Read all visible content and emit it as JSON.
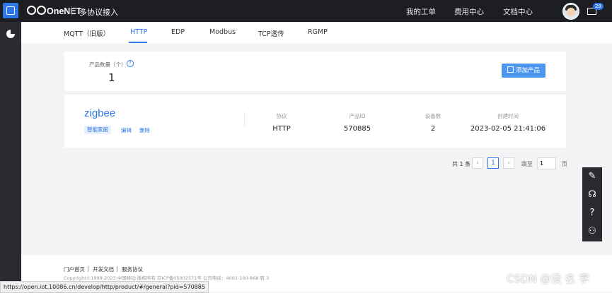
{
  "header": {
    "brand": "OneNET",
    "subtitle": "多协议接入",
    "nav": [
      "我的工单",
      "费用中心",
      "文档中心"
    ],
    "mail_badge": "28"
  },
  "tabs": [
    {
      "label": "MQTT（旧版）",
      "active": false
    },
    {
      "label": "HTTP",
      "active": true
    },
    {
      "label": "EDP",
      "active": false
    },
    {
      "label": "Modbus",
      "active": false
    },
    {
      "label": "TCP透传",
      "active": false
    },
    {
      "label": "RGMP",
      "active": false
    }
  ],
  "summary": {
    "count_label": "产品数量（个）",
    "count_value": "1",
    "add_button": "添加产品"
  },
  "product": {
    "name": "zigbee",
    "tag": "智能家居",
    "edit": "编辑",
    "delete": "删除",
    "columns": [
      {
        "label": "协议",
        "value": "HTTP"
      },
      {
        "label": "产品ID",
        "value": "570885"
      },
      {
        "label": "设备数",
        "value": "2"
      },
      {
        "label": "创建时间",
        "value": "2023-02-05 21:41:06"
      }
    ]
  },
  "pagination": {
    "total": "共 1 条",
    "current_page": "1",
    "goto_label": "跳至",
    "goto_value": "1",
    "page_word": "页"
  },
  "footer": {
    "links": [
      "门户首页",
      "开发文档",
      "服务协议"
    ],
    "copyright": "Copyright©1999-2023 中国移动 版权所有 京ICP备05002571号 公司电话：4001-100-868 转 3"
  },
  "status_url": "https://open.iot.10086.cn/develop/http/product/#/general?pid=570885",
  "watermark": "CSDN @没 名 字",
  "colors": {
    "accent": "#2f76e6",
    "topbar": "#1d1e22",
    "sidebar": "#2a2b30"
  },
  "icons": [
    "logo-icon",
    "chart-icon",
    "mail-icon",
    "help-icon",
    "box-icon",
    "edit-icon",
    "headset-icon",
    "question-icon",
    "users-icon"
  ]
}
